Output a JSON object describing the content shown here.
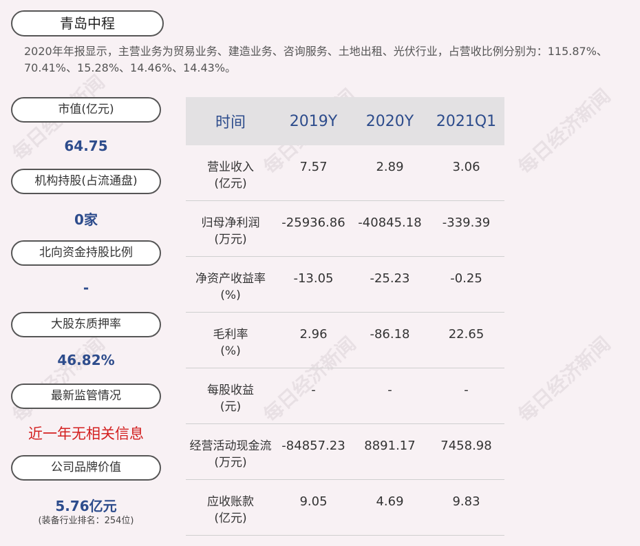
{
  "company": {
    "name": "青岛中程"
  },
  "summary": "2020年年报显示，主营业务为贸易业务、建造业务、咨询服务、土地出租、光伏行业，占营收比例分别为：115.87%、70.41%、15.28%、14.46%、14.43%。",
  "sidebar": [
    {
      "label": "市值(亿元)",
      "value": "64.75"
    },
    {
      "label": "机构持股(占流通盘)",
      "value": "0家"
    },
    {
      "label": "北向资金持股比例",
      "value": "-"
    },
    {
      "label": "大股东质押率",
      "value": "46.82%"
    },
    {
      "label": "最新监管情况",
      "value": "近一年无相关信息"
    },
    {
      "label": "公司品牌价值",
      "value": "5.76亿元",
      "sub": "(装备行业排名：254位)"
    }
  ],
  "table": {
    "headers": [
      "时间",
      "2019Y",
      "2020Y",
      "2021Q1"
    ],
    "rows": [
      {
        "label1": "营业收入",
        "label2": "(亿元)",
        "v": [
          "7.57",
          "2.89",
          "3.06"
        ]
      },
      {
        "label1": "归母净利润",
        "label2": "(万元)",
        "v": [
          "-25936.86",
          "-40845.18",
          "-339.39"
        ]
      },
      {
        "label1": "净资产收益率",
        "label2": "(%)",
        "v": [
          "-13.05",
          "-25.23",
          "-0.25"
        ]
      },
      {
        "label1": "毛利率",
        "label2": "(%)",
        "v": [
          "2.96",
          "-86.18",
          "22.65"
        ]
      },
      {
        "label1": "每股收益",
        "label2": "(元)",
        "v": [
          "-",
          "-",
          "-"
        ]
      },
      {
        "label1": "经营活动现金流",
        "label2": "(万元)",
        "v": [
          "-84857.23",
          "8891.17",
          "7458.98"
        ]
      },
      {
        "label1": "应收账款",
        "label2": "(亿元)",
        "v": [
          "9.05",
          "4.69",
          "9.83"
        ]
      }
    ]
  },
  "watermark": "每日经济新闻"
}
